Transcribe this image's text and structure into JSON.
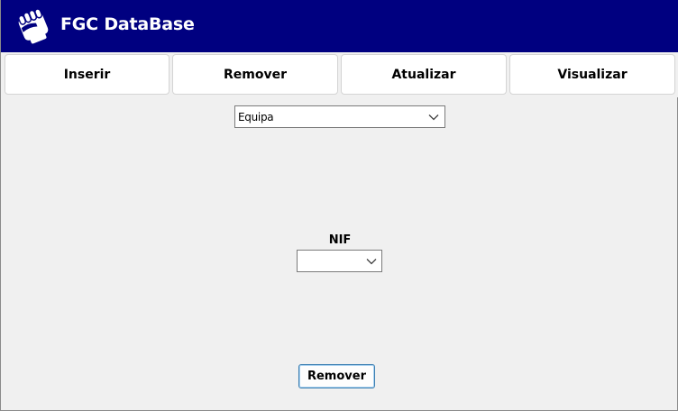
{
  "app": {
    "title": "FGC DataBase",
    "logo_icon": "fist-icon"
  },
  "colors": {
    "header_bg": "#000080",
    "window_bg": "#f0f0f0"
  },
  "nav": {
    "items": [
      {
        "label": "Inserir"
      },
      {
        "label": "Remover"
      },
      {
        "label": "Atualizar"
      },
      {
        "label": "Visualizar"
      }
    ]
  },
  "table_select": {
    "value": "Equipa"
  },
  "nif": {
    "label": "NIF",
    "value": ""
  },
  "action": {
    "label": "Remover"
  }
}
